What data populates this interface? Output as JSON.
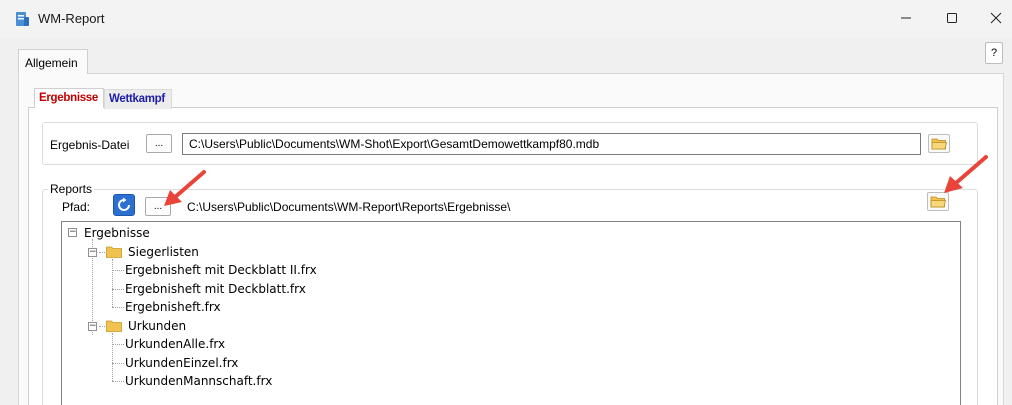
{
  "window": {
    "title": "WM-Report"
  },
  "help_label": "?",
  "tabs": {
    "outer": "Allgemein",
    "inner_active": "Ergebnisse",
    "inner_other": "Wettkampf"
  },
  "result_file": {
    "label": "Ergebnis-Datei",
    "browse_label": "...",
    "path": "C:\\Users\\Public\\Documents\\WM-Shot\\Export\\GesamtDemowettkampf80.mdb"
  },
  "reports": {
    "legend": "Reports",
    "path_label": "Pfad:",
    "browse_label": "...",
    "path": "C:\\Users\\Public\\Documents\\WM-Report\\Reports\\Ergebnisse\\"
  },
  "tree": {
    "root": "Ergebnisse",
    "groups": [
      {
        "label": "Siegerlisten",
        "items": [
          "Ergebnisheft mit Deckblatt II.frx",
          "Ergebnisheft mit Deckblatt.frx",
          "Ergebnisheft.frx"
        ]
      },
      {
        "label": "Urkunden",
        "items": [
          "UrkundenAlle.frx",
          "UrkundenEinzel.frx",
          "UrkundenMannschaft.frx"
        ]
      }
    ]
  },
  "colors": {
    "active_tab_text": "#c00000",
    "inactive_tab_text": "#1e1ea8",
    "annotation_arrow": "#e8443a",
    "folder": "#f2c14e"
  },
  "icons": [
    "app-icon",
    "minimize-icon",
    "maximize-icon",
    "close-icon",
    "refresh-icon",
    "folder-open-icon",
    "folder-icon",
    "annotation-arrow"
  ]
}
